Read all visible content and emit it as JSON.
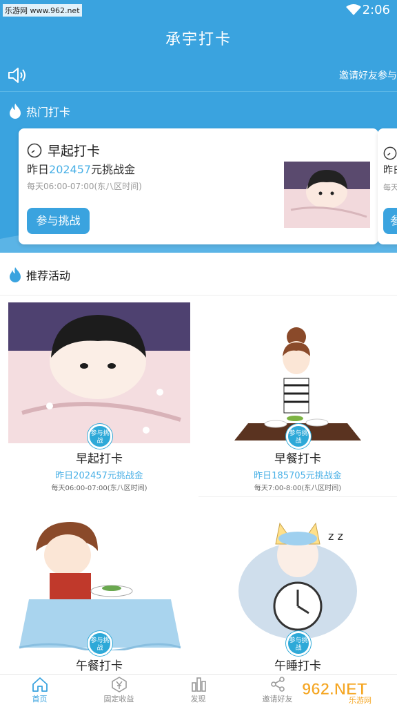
{
  "status_bar": {
    "watermark": "乐游网 www.962.net",
    "time": "2:06"
  },
  "app": {
    "title": "承宇打卡"
  },
  "notice": {
    "text": "邀请好友参与"
  },
  "hot": {
    "section_title": "热门打卡",
    "card": {
      "title": "早起打卡",
      "prize_prefix": "昨日",
      "prize_amount": "202457",
      "prize_suffix": "元挑战金",
      "time": "每天06:00-07:00(东八区时间)",
      "button": "参与挑战"
    },
    "peek_card": {
      "line": "昨日",
      "time": "每天",
      "button": "参"
    }
  },
  "recommend": {
    "section_title": "推荐活动",
    "badge": "参与挑战",
    "items": [
      {
        "name": "早起打卡",
        "prize": "昨日202457元挑战金",
        "time": "每天06:00-07:00(东八区时间)"
      },
      {
        "name": "早餐打卡",
        "prize": "昨日185705元挑战金",
        "time": "每天7:00-8:00(东八区时间)"
      },
      {
        "name": "午餐打卡"
      },
      {
        "name": "午睡打卡"
      }
    ]
  },
  "tabbar": {
    "items": [
      {
        "label": "首页",
        "icon": "home-icon",
        "active": true
      },
      {
        "label": "固定收益",
        "icon": "yen-icon"
      },
      {
        "label": "发现",
        "icon": "chart-icon"
      },
      {
        "label": "邀请好友",
        "icon": "share-icon"
      }
    ]
  },
  "watermark": {
    "text": "962.NET",
    "sub": "乐游网"
  },
  "colors": {
    "primary": "#3aa3df",
    "accent_text": "#49b0e6"
  }
}
